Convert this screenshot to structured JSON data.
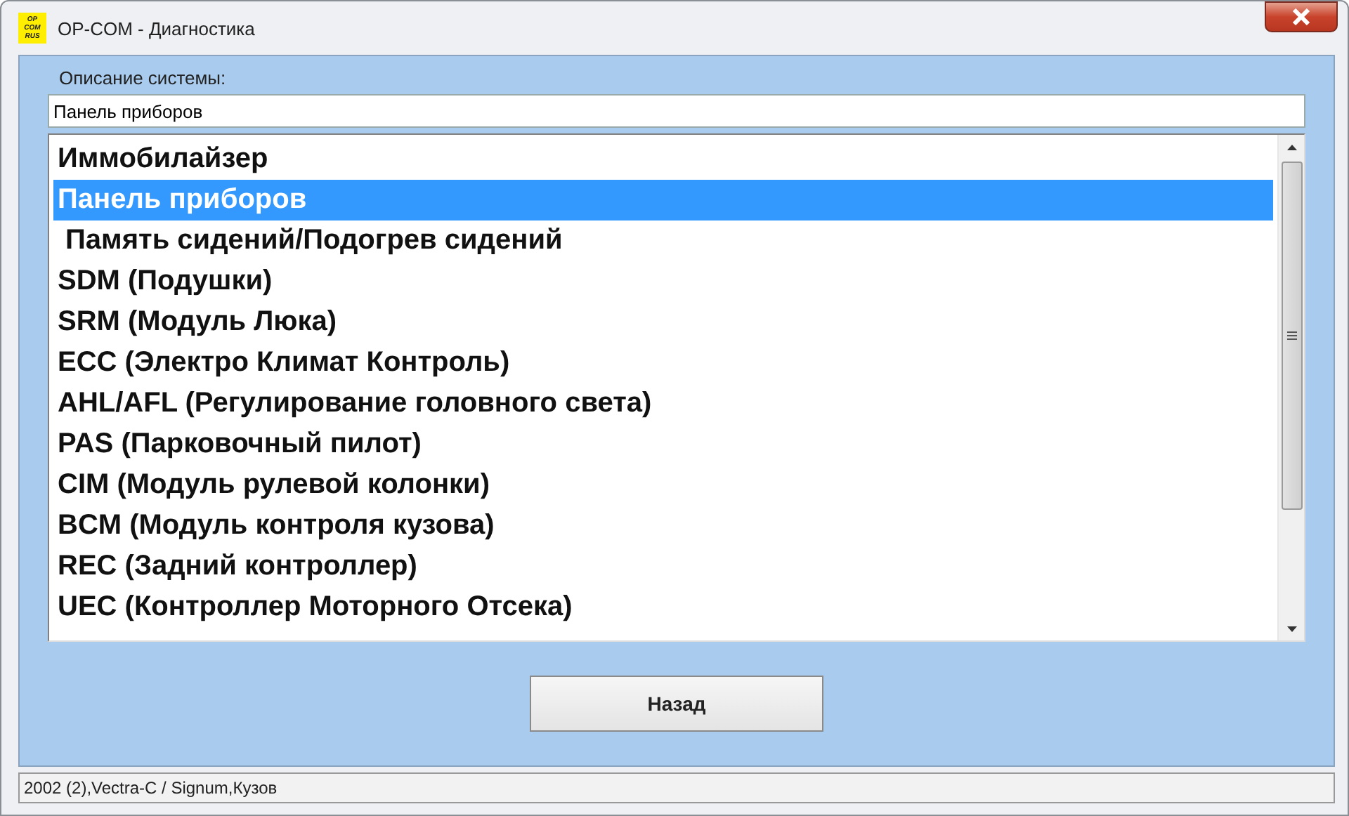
{
  "window": {
    "logo": [
      "OP",
      "COM",
      "RUS"
    ],
    "title": "OP-COM - Диагностика"
  },
  "description": {
    "label": "Описание системы:",
    "value": "Панель приборов"
  },
  "systems": [
    {
      "label": "Иммобилайзер",
      "selected": false
    },
    {
      "label": "Панель приборов",
      "selected": true
    },
    {
      "label": " Память сидений/Подогрев сидений",
      "selected": false
    },
    {
      "label": "SDM (Подушки)",
      "selected": false
    },
    {
      "label": "SRM (Модуль Люка)",
      "selected": false
    },
    {
      "label": "ECC (Электро Климат Контроль)",
      "selected": false
    },
    {
      "label": "AHL/AFL (Регулирование головного света)",
      "selected": false
    },
    {
      "label": "PAS (Парковочный пилот)",
      "selected": false
    },
    {
      "label": "CIM (Модуль рулевой колонки)",
      "selected": false
    },
    {
      "label": "BCM (Модуль контроля кузова)",
      "selected": false
    },
    {
      "label": "REC (Задний контроллер)",
      "selected": false
    },
    {
      "label": "UEC (Контроллер Моторного Отсека)",
      "selected": false
    }
  ],
  "buttons": [
    "Назад"
  ],
  "status_bar": "2002 (2),Vectra-C / Signum,Кузов"
}
